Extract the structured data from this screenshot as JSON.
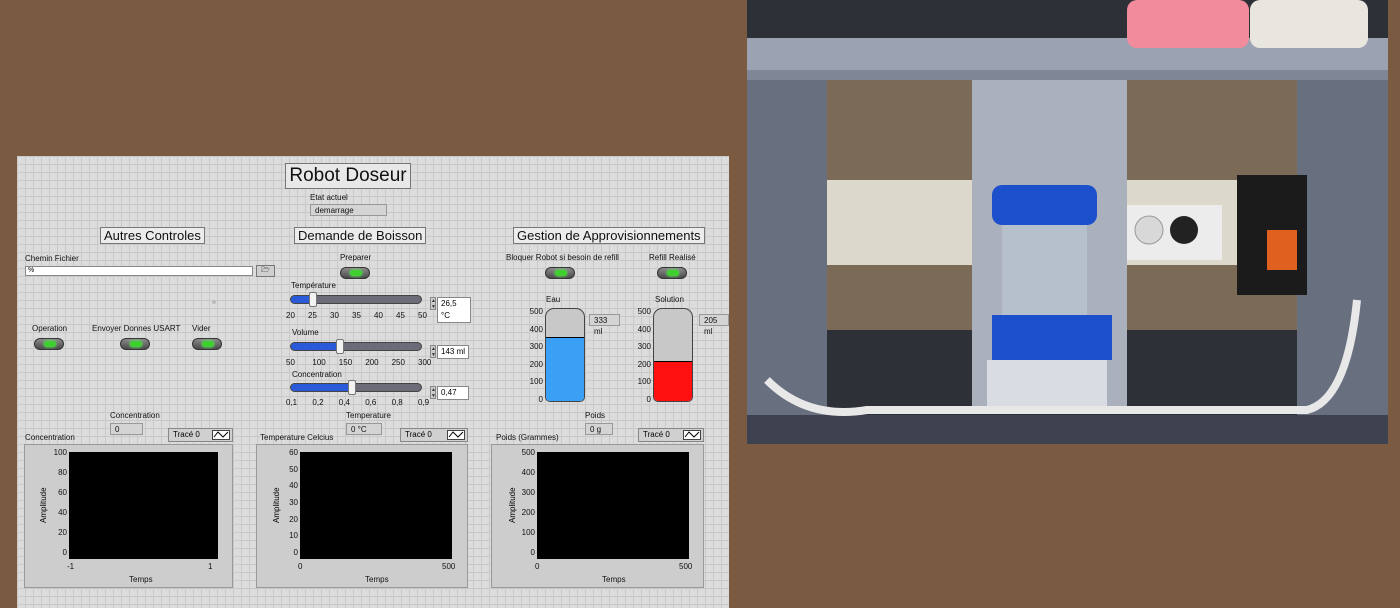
{
  "title": "Robot Doseur",
  "etat": {
    "label": "Etat actuel",
    "value": "demarrage"
  },
  "sections": {
    "autres": "Autres Controles",
    "demande": "Demande de Boisson",
    "gestion": "Gestion de Approvisionnements"
  },
  "autres": {
    "chemin_label": "Chemin Fichier",
    "chemin_value": "%",
    "browse": "🗁",
    "operation": "Operation",
    "usart": "Envoyer Donnes USART",
    "vider": "Vider"
  },
  "demande": {
    "preparer": "Preparer",
    "temperature": {
      "label": "Température",
      "value": "26,5 °C",
      "level": 0.163,
      "ticks": [
        "20",
        "25",
        "30",
        "35",
        "40",
        "45",
        "50"
      ]
    },
    "volume": {
      "label": "Volume",
      "value": "143 ml",
      "level": 0.373,
      "ticks": [
        "50",
        "100",
        "150",
        "200",
        "250",
        "300"
      ]
    },
    "concentration": {
      "label": "Concentration",
      "value": "0,47",
      "level": 0.463,
      "ticks": [
        "0,1",
        "0,2",
        "0,4",
        "0,6",
        "0,8",
        "0,9"
      ]
    }
  },
  "gestion": {
    "bloquer": "Bloquer Robot si besoin de refill",
    "refill": "Refill Realisé",
    "eau": {
      "label": "Eau",
      "value": "333 ml",
      "level": 333,
      "max": 500,
      "color": "#3aa0f6"
    },
    "solution": {
      "label": "Solution",
      "value": "205 ml",
      "level": 205,
      "max": 500,
      "color": "#ff1010"
    },
    "ticks": [
      "500",
      "400",
      "300",
      "200",
      "100",
      "0"
    ]
  },
  "charts": [
    {
      "indicator_label": "Concentration",
      "indicator_value": "0",
      "name": "Concentration",
      "legend": "Tracé 0",
      "ylabel": "Amplitude",
      "xlabel": "Temps",
      "yticks": [
        "100",
        "80",
        "60",
        "40",
        "20",
        "0"
      ],
      "xticks": [
        "-1",
        "1"
      ]
    },
    {
      "indicator_label": "Temperature",
      "indicator_value": "0 °C",
      "name": "Temperature Celcius",
      "legend": "Tracé 0",
      "ylabel": "Amplitude",
      "xlabel": "Temps",
      "yticks": [
        "60",
        "50",
        "40",
        "30",
        "20",
        "10",
        "0"
      ],
      "xticks": [
        "0",
        "500"
      ]
    },
    {
      "indicator_label": "Poids",
      "indicator_value": "0 g",
      "name": "Poids (Grammes)",
      "legend": "Tracé 0",
      "ylabel": "Amplitude",
      "xlabel": "Temps",
      "yticks": [
        "500",
        "400",
        "300",
        "200",
        "100",
        "0"
      ],
      "xticks": [
        "0",
        "500"
      ]
    }
  ],
  "colors": {
    "led_on": "#3fd030",
    "slider": "#2a5ad8",
    "background": "#7a5a40"
  }
}
